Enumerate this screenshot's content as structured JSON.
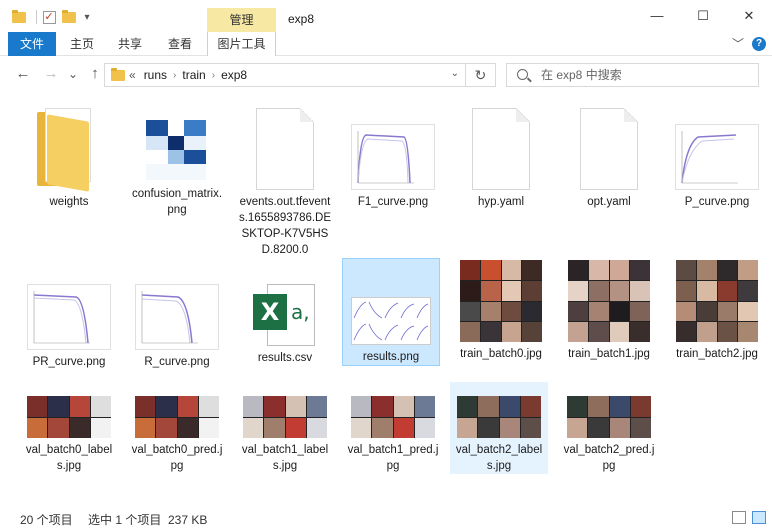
{
  "titlebar": {
    "window_title": "exp8",
    "manage_tab": "管理",
    "qa_dropdown": "▾",
    "minimize": "—",
    "maximize": "☐",
    "close": "✕"
  },
  "ribbon": {
    "tabs": [
      "文件",
      "主页",
      "共享",
      "查看",
      "图片工具"
    ],
    "expand": "﹀",
    "help": "?"
  },
  "nav": {
    "back": "←",
    "forward": "→",
    "recent": "⌄",
    "up": "↑",
    "breadcrumb": [
      "«",
      "runs",
      "train",
      "exp8"
    ],
    "refresh": "↻",
    "search_placeholder": "在 exp8 中搜索"
  },
  "files": [
    {
      "name": "weights",
      "type": "folder"
    },
    {
      "name": "confusion_matrix.png",
      "type": "matrix"
    },
    {
      "name": "events.out.tfevents.1655893786.DESKTOP-K7V5HSD.8200.0",
      "type": "doc"
    },
    {
      "name": "F1_curve.png",
      "type": "curve"
    },
    {
      "name": "hyp.yaml",
      "type": "doc"
    },
    {
      "name": "opt.yaml",
      "type": "doc"
    },
    {
      "name": "P_curve.png",
      "type": "curve"
    },
    {
      "name": "PR_curve.png",
      "type": "curve"
    },
    {
      "name": "R_curve.png",
      "type": "curve"
    },
    {
      "name": "results.csv",
      "type": "excel"
    },
    {
      "name": "results.png",
      "type": "results"
    },
    {
      "name": "train_batch0.jpg",
      "type": "photo"
    },
    {
      "name": "train_batch1.jpg",
      "type": "photo"
    },
    {
      "name": "train_batch2.jpg",
      "type": "photo"
    },
    {
      "name": "val_batch0_labels.jpg",
      "type": "val"
    },
    {
      "name": "val_batch0_pred.jpg",
      "type": "val"
    },
    {
      "name": "val_batch1_labels.jpg",
      "type": "val"
    },
    {
      "name": "val_batch1_pred.jpg",
      "type": "val"
    },
    {
      "name": "val_batch2_labels.jpg",
      "type": "val"
    },
    {
      "name": "val_batch2_pred.jpg",
      "type": "val"
    }
  ],
  "status": {
    "count": "20 个项目",
    "selection": "选中 1 个项目  237 KB"
  },
  "colors": {
    "accent": "#1979ca",
    "selected_bg": "#cce8ff",
    "manage_tab_bg": "#f7e9a3",
    "excel_green": "#1d7044",
    "folder_yellow": "#f5cf62"
  }
}
